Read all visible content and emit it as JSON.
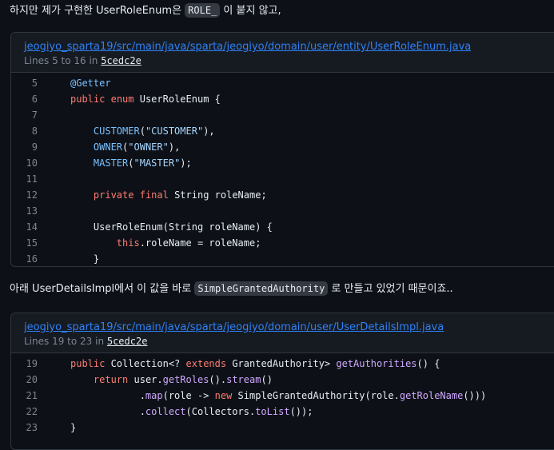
{
  "para1": {
    "before": "하지만 제가 구현한 UserRoleEnum은 ",
    "code": "ROLE_",
    "after": " 이 붙지 않고,"
  },
  "block1": {
    "path": "jeogiyo_sparta19/src/main/java/sparta/jeogiyo/domain/user/entity/UserRoleEnum.java",
    "lines_prefix": "Lines 5 to 16 in ",
    "sha": "5cedc2e",
    "line_numbers": [
      "5",
      "6",
      "7",
      "8",
      "9",
      "10",
      "11",
      "12",
      "13",
      "14",
      "15",
      "16"
    ]
  },
  "para2": {
    "before": "아래 UserDetailsImpl에서 이 값을 바로 ",
    "code": "SimpleGrantedAuthority",
    "after": " 로 만들고 있었기 때문이죠.."
  },
  "block2": {
    "path": "jeogiyo_sparta19/src/main/java/sparta/jeogiyo/domain/user/UserDetailsImpl.java",
    "lines_prefix": "Lines 19 to 23 in ",
    "sha": "5cedc2e",
    "line_numbers": [
      "19",
      "20",
      "21",
      "22",
      "23"
    ]
  },
  "code1": [
    [
      {
        "t": "@Getter",
        "c": "an"
      }
    ],
    [
      {
        "t": "public",
        "c": "kw"
      },
      {
        "t": " "
      },
      {
        "t": "enum",
        "c": "kw"
      },
      {
        "t": " UserRoleEnum {"
      }
    ],
    [],
    [
      {
        "t": "    "
      },
      {
        "t": "CUSTOMER",
        "c": "cn"
      },
      {
        "t": "("
      },
      {
        "t": "\"CUSTOMER\"",
        "c": "st"
      },
      {
        "t": "),"
      }
    ],
    [
      {
        "t": "    "
      },
      {
        "t": "OWNER",
        "c": "cn"
      },
      {
        "t": "("
      },
      {
        "t": "\"OWNER\"",
        "c": "st"
      },
      {
        "t": "),"
      }
    ],
    [
      {
        "t": "    "
      },
      {
        "t": "MASTER",
        "c": "cn"
      },
      {
        "t": "("
      },
      {
        "t": "\"MASTER\"",
        "c": "st"
      },
      {
        "t": ");"
      }
    ],
    [],
    [
      {
        "t": "    "
      },
      {
        "t": "private",
        "c": "kw"
      },
      {
        "t": " "
      },
      {
        "t": "final",
        "c": "kw"
      },
      {
        "t": " String roleName;"
      }
    ],
    [],
    [
      {
        "t": "    UserRoleEnum(String roleName) {"
      }
    ],
    [
      {
        "t": "        "
      },
      {
        "t": "this",
        "c": "kw"
      },
      {
        "t": ".roleName = roleName;"
      }
    ],
    [
      {
        "t": "    }"
      }
    ]
  ],
  "code2": [
    [
      {
        "t": "public",
        "c": "kw"
      },
      {
        "t": " Collection<? "
      },
      {
        "t": "extends",
        "c": "kw"
      },
      {
        "t": " GrantedAuthority> "
      },
      {
        "t": "getAuthorities",
        "c": "fn"
      },
      {
        "t": "() {"
      }
    ],
    [
      {
        "t": "    "
      },
      {
        "t": "return",
        "c": "kw"
      },
      {
        "t": " user."
      },
      {
        "t": "getRoles",
        "c": "fn"
      },
      {
        "t": "()."
      },
      {
        "t": "stream",
        "c": "fn"
      },
      {
        "t": "()"
      }
    ],
    [
      {
        "t": "            ."
      },
      {
        "t": "map",
        "c": "fn"
      },
      {
        "t": "(role -> "
      },
      {
        "t": "new",
        "c": "kw"
      },
      {
        "t": " SimpleGrantedAuthority(role."
      },
      {
        "t": "getRoleName",
        "c": "fn"
      },
      {
        "t": "()))"
      }
    ],
    [
      {
        "t": "            ."
      },
      {
        "t": "collect",
        "c": "fn"
      },
      {
        "t": "(Collectors."
      },
      {
        "t": "toList",
        "c": "fn"
      },
      {
        "t": "());"
      }
    ],
    [
      {
        "t": "}"
      }
    ]
  ]
}
